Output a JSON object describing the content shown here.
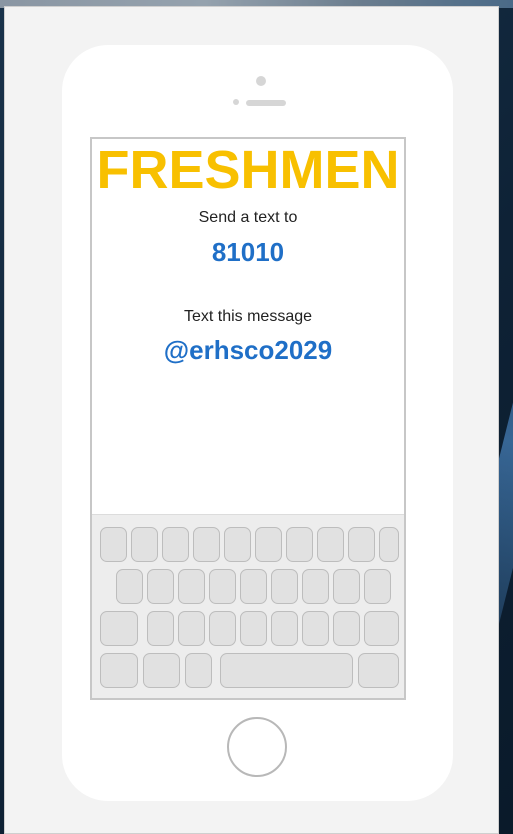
{
  "screen": {
    "title": "FRESHMEN",
    "instruction_1": "Send a text to",
    "phone_number": "81010",
    "instruction_2": "Text this message",
    "message_code": "@erhsco2029"
  },
  "colors": {
    "title": "#f8c000",
    "highlight": "#1f6fc7",
    "phone_body": "#ffffff",
    "card_background": "#f3f3f3"
  },
  "keyboard": {
    "rows": [
      10,
      9,
      9,
      4
    ]
  }
}
